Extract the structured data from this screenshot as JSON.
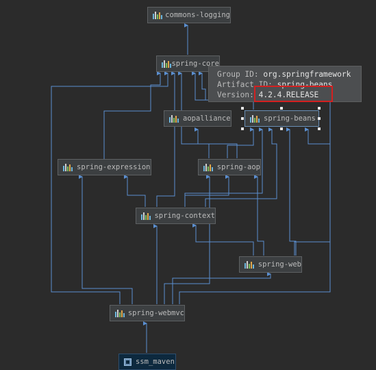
{
  "nodes": [
    {
      "id": "commons-logging",
      "label": "commons-logging"
    },
    {
      "id": "spring-core",
      "label": "spring-core"
    },
    {
      "id": "aopalliance",
      "label": "aopalliance"
    },
    {
      "id": "spring-beans",
      "label": "spring-beans"
    },
    {
      "id": "spring-expression",
      "label": "spring-expression"
    },
    {
      "id": "spring-aop",
      "label": "spring-aop"
    },
    {
      "id": "spring-context",
      "label": "spring-context"
    },
    {
      "id": "spring-web",
      "label": "spring-web"
    },
    {
      "id": "spring-webmvc",
      "label": "spring-webmvc"
    },
    {
      "id": "ssm_maven",
      "label": "ssm_maven"
    }
  ],
  "tooltip": {
    "group_label": "Group ID:",
    "group_value": "org.springframework",
    "artifact_label": "Artifact ID:",
    "artifact_value": "spring-beans",
    "version_label": "Version:",
    "version_value": "4.2.4.RELEASE"
  },
  "colors": {
    "edge": "#5b8fd0",
    "highlight": "#d42020",
    "background": "#2b2b2b"
  }
}
